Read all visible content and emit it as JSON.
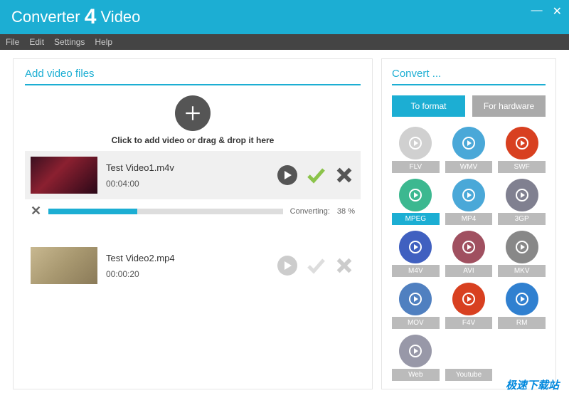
{
  "app": {
    "title_pre": "Converter",
    "title_num": "4",
    "title_post": "Video"
  },
  "menu": {
    "file": "File",
    "edit": "Edit",
    "settings": "Settings",
    "help": "Help"
  },
  "left": {
    "title": "Add video files",
    "hint": "Click to add video or drag & drop it here"
  },
  "videos": [
    {
      "name": "Test Video1.m4v",
      "duration": "00:04:00",
      "active": true,
      "progress_label": "Converting:",
      "progress_pct": "38 %",
      "progress_val": 38
    },
    {
      "name": "Test Video2.mp4",
      "duration": "00:00:20",
      "active": false
    }
  ],
  "right": {
    "title": "Convert ...",
    "tab_format": "To format",
    "tab_hardware": "For hardware"
  },
  "formats": [
    {
      "label": "FLV",
      "color": "#d0d0d0",
      "sel": false
    },
    {
      "label": "WMV",
      "color": "#4aa8d8",
      "sel": false
    },
    {
      "label": "SWF",
      "color": "#d84020",
      "sel": false
    },
    {
      "label": "MPEG",
      "color": "#3cb890",
      "sel": true
    },
    {
      "label": "MP4",
      "color": "#4aa8d8",
      "sel": false
    },
    {
      "label": "3GP",
      "color": "#808090",
      "sel": false
    },
    {
      "label": "M4V",
      "color": "#4060c0",
      "sel": false
    },
    {
      "label": "AVI",
      "color": "#a05060",
      "sel": false
    },
    {
      "label": "MKV",
      "color": "#888888",
      "sel": false
    },
    {
      "label": "MOV",
      "color": "#5080c0",
      "sel": false
    },
    {
      "label": "F4V",
      "color": "#d84020",
      "sel": false
    },
    {
      "label": "RM",
      "color": "#3080d0",
      "sel": false
    },
    {
      "label": "Web",
      "color": "#9898a8",
      "sel": false
    },
    {
      "label": "Youtube",
      "color": "#ffffff",
      "sel": false
    }
  ],
  "watermark": "极速下载站"
}
